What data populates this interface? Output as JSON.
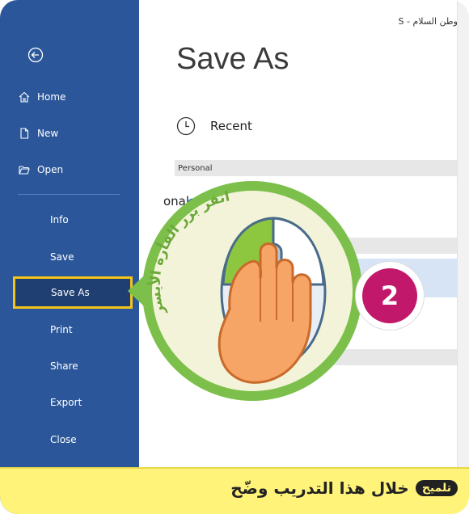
{
  "window": {
    "document_title": "وطن السلام - S",
    "page_title": "Save As"
  },
  "sidebar": {
    "back_icon": "back-arrow-icon",
    "items": [
      {
        "label": "Home",
        "icon": "home-icon"
      },
      {
        "label": "New",
        "icon": "new-document-icon"
      },
      {
        "label": "Open",
        "icon": "open-folder-icon"
      },
      {
        "label": "Info"
      },
      {
        "label": "Save"
      },
      {
        "label": "Save As"
      },
      {
        "label": "Print"
      },
      {
        "label": "Share"
      },
      {
        "label": "Export"
      },
      {
        "label": "Close"
      }
    ]
  },
  "locations": {
    "recent_label": "Recent",
    "personal_header": "Personal",
    "onedrive_label": "onal"
  },
  "callout": {
    "instruction": "انقر بزر الفأرة الأيسر",
    "step_number": "2",
    "accent_color": "#7cc04b",
    "badge_color": "#c2186b"
  },
  "tip": {
    "tag": "تلميح",
    "text": "خلال هذا التدريب وضّح"
  },
  "colors": {
    "sidebar": "#2b579a",
    "highlight_border": "#f3c41b",
    "tip_background": "#fff37a"
  }
}
